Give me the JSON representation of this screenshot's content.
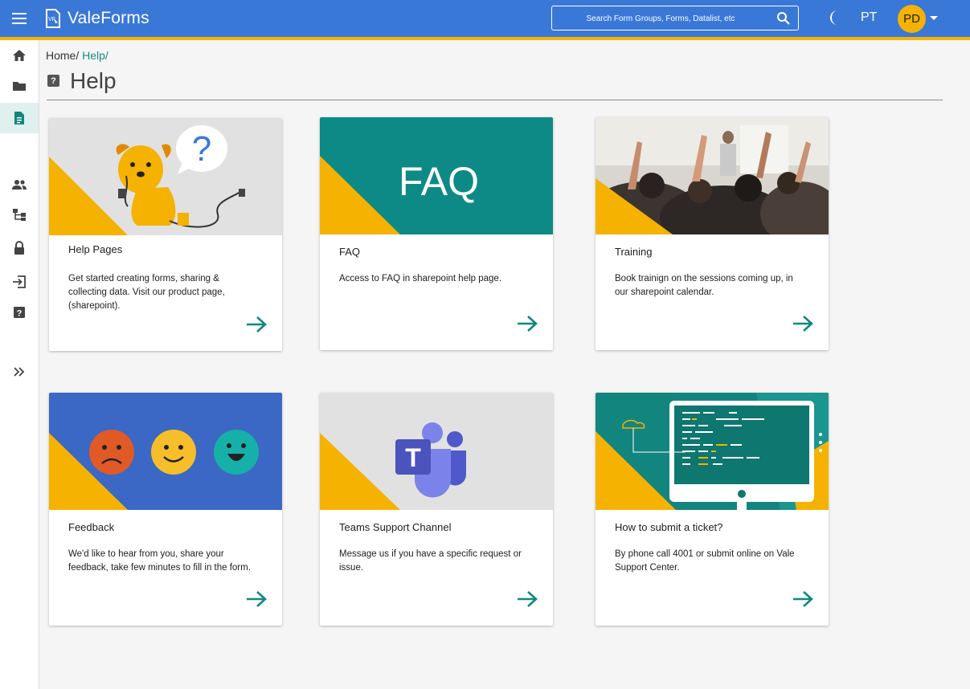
{
  "app": {
    "title": "ValeForms",
    "logo_text": "VF"
  },
  "search": {
    "placeholder": "Search Form Groups, Forms, Datalist, etc"
  },
  "header": {
    "lang": "PT",
    "avatar_initials": "PD"
  },
  "sidebar": {
    "items": [
      {
        "name": "home-icon",
        "active": false
      },
      {
        "name": "folder-icon",
        "active": false
      },
      {
        "name": "document-icon",
        "active": true
      },
      {
        "name": "people-icon",
        "active": false
      },
      {
        "name": "hierarchy-icon",
        "active": false
      },
      {
        "name": "lock-icon",
        "active": false
      },
      {
        "name": "logout-icon",
        "active": false
      },
      {
        "name": "help-icon",
        "active": false
      },
      {
        "name": "expand-icon",
        "active": false
      }
    ]
  },
  "breadcrumb": {
    "home": "Home/",
    "current": "Help/"
  },
  "page": {
    "title": "Help",
    "title_icon": "?"
  },
  "cards": [
    {
      "title": "Help Pages",
      "desc": "Get started creating forms, sharing & collecting data. Visit our product page, (sharepoint).",
      "image": "dog-plug-illustration"
    },
    {
      "title": "FAQ",
      "desc": "Access to FAQ in sharepoint help page.",
      "image": "faq-banner",
      "banner_text": "FAQ"
    },
    {
      "title": "Training",
      "desc": "Book trainign on the sessions coming up, in our sharepoint calendar.",
      "image": "audience-raising-hands-photo"
    },
    {
      "title": "Feedback",
      "desc": "We'd like to hear from you, share your feedback, take few minutes to fill in the form.",
      "image": "emoji-faces"
    },
    {
      "title": "Teams Support Channel",
      "desc": "Message us if you have a specific request or issue.",
      "image": "teams-logo",
      "logo_letter": "T"
    },
    {
      "title": "How to submit a ticket?",
      "desc": "By phone call 4001 or submit online on Vale Support Center.",
      "image": "monitor-code-illustration"
    }
  ],
  "colors": {
    "topbar": "#3a78d8",
    "accent": "#f5b200",
    "teal": "#0d8a86",
    "arrow": "#13877f"
  }
}
